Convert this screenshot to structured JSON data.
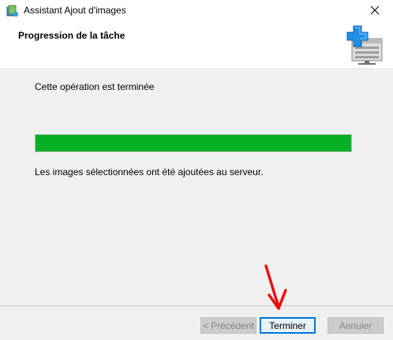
{
  "window": {
    "title": "Assistant Ajout d'images",
    "icon": "app-wizard-icon",
    "close_icon": "close-icon"
  },
  "header": {
    "title": "Progression de la tâche",
    "graphic": "server-add-icon"
  },
  "content": {
    "status": "Cette opération est terminée",
    "progress": 1.0,
    "progress_color": "#06b025",
    "result": "Les images sélectionnées ont été ajoutées au serveur."
  },
  "footer": {
    "previous_label": "< Précédent",
    "finish_label": "Terminer",
    "cancel_label": "Annuler"
  },
  "annotation": {
    "arrow_color": "#e81010"
  }
}
